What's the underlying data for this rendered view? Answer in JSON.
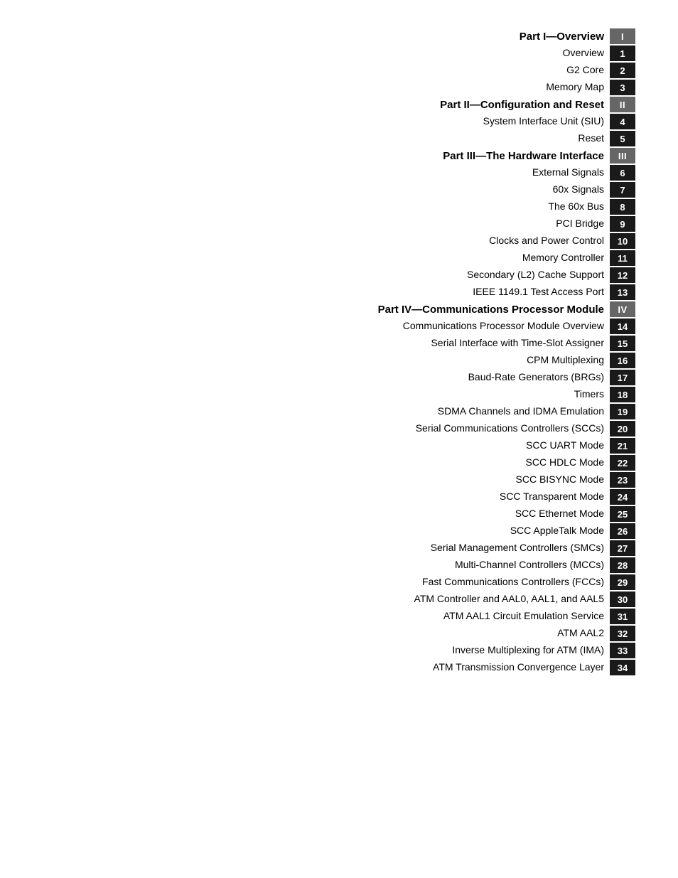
{
  "toc": {
    "items": [
      {
        "label": "Part I—Overview",
        "badge": "I",
        "isPart": true,
        "isRoman": true
      },
      {
        "label": "Overview",
        "badge": "1",
        "isPart": false
      },
      {
        "label": "G2 Core",
        "badge": "2",
        "isPart": false
      },
      {
        "label": "Memory Map",
        "badge": "3",
        "isPart": false
      },
      {
        "label": "Part II—Configuration and Reset",
        "badge": "II",
        "isPart": true,
        "isRoman": true
      },
      {
        "label": "System Interface Unit (SIU)",
        "badge": "4",
        "isPart": false
      },
      {
        "label": "Reset",
        "badge": "5",
        "isPart": false
      },
      {
        "label": "Part III—The Hardware Interface",
        "badge": "III",
        "isPart": true,
        "isRoman": true
      },
      {
        "label": "External Signals",
        "badge": "6",
        "isPart": false
      },
      {
        "label": "60x Signals",
        "badge": "7",
        "isPart": false
      },
      {
        "label": "The 60x Bus",
        "badge": "8",
        "isPart": false
      },
      {
        "label": "PCI Bridge",
        "badge": "9",
        "isPart": false
      },
      {
        "label": "Clocks and Power Control",
        "badge": "10",
        "isPart": false
      },
      {
        "label": "Memory Controller",
        "badge": "11",
        "isPart": false
      },
      {
        "label": "Secondary (L2) Cache Support",
        "badge": "12",
        "isPart": false
      },
      {
        "label": "IEEE 1149.1 Test Access Port",
        "badge": "13",
        "isPart": false
      },
      {
        "label": "Part IV—Communications Processor Module",
        "badge": "IV",
        "isPart": true,
        "isRoman": true
      },
      {
        "label": "Communications Processor Module Overview",
        "badge": "14",
        "isPart": false
      },
      {
        "label": "Serial Interface with Time-Slot Assigner",
        "badge": "15",
        "isPart": false
      },
      {
        "label": "CPM Multiplexing",
        "badge": "16",
        "isPart": false
      },
      {
        "label": "Baud-Rate Generators (BRGs)",
        "badge": "17",
        "isPart": false
      },
      {
        "label": "Timers",
        "badge": "18",
        "isPart": false
      },
      {
        "label": "SDMA Channels and IDMA Emulation",
        "badge": "19",
        "isPart": false
      },
      {
        "label": "Serial Communications Controllers (SCCs)",
        "badge": "20",
        "isPart": false
      },
      {
        "label": "SCC UART Mode",
        "badge": "21",
        "isPart": false
      },
      {
        "label": "SCC HDLC Mode",
        "badge": "22",
        "isPart": false
      },
      {
        "label": "SCC BISYNC Mode",
        "badge": "23",
        "isPart": false
      },
      {
        "label": "SCC Transparent Mode",
        "badge": "24",
        "isPart": false
      },
      {
        "label": "SCC Ethernet Mode",
        "badge": "25",
        "isPart": false
      },
      {
        "label": "SCC AppleTalk Mode",
        "badge": "26",
        "isPart": false
      },
      {
        "label": "Serial Management Controllers (SMCs)",
        "badge": "27",
        "isPart": false
      },
      {
        "label": "Multi-Channel Controllers (MCCs)",
        "badge": "28",
        "isPart": false
      },
      {
        "label": "Fast Communications Controllers (FCCs)",
        "badge": "29",
        "isPart": false
      },
      {
        "label": "ATM Controller and AAL0, AAL1, and AAL5",
        "badge": "30",
        "isPart": false
      },
      {
        "label": "ATM AAL1 Circuit Emulation Service",
        "badge": "31",
        "isPart": false
      },
      {
        "label": "ATM AAL2",
        "badge": "32",
        "isPart": false
      },
      {
        "label": "Inverse Multiplexing for ATM (IMA)",
        "badge": "33",
        "isPart": false
      },
      {
        "label": "ATM Transmission Convergence Layer",
        "badge": "34",
        "isPart": false
      }
    ]
  }
}
